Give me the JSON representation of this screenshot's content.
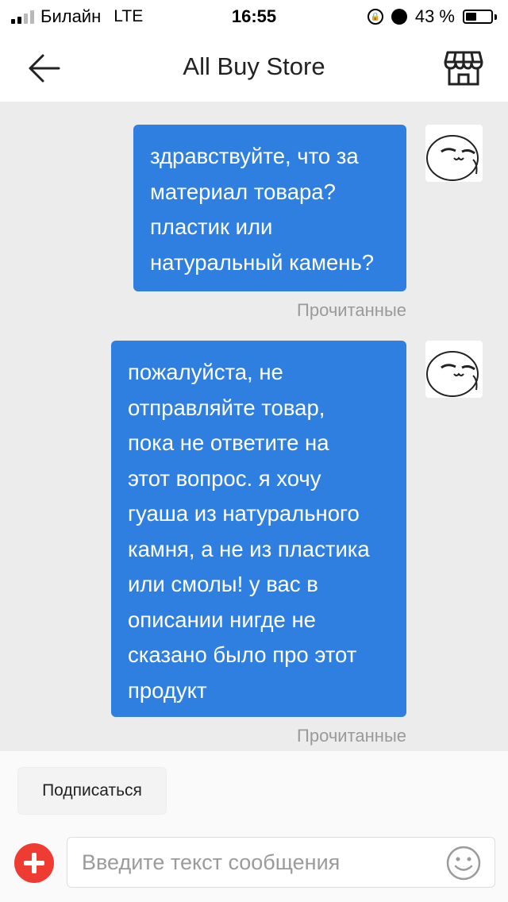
{
  "status_bar": {
    "carrier": "Билайн",
    "network": "LTE",
    "time": "16:55",
    "battery_text": "43 %",
    "battery_level": 0.43
  },
  "header": {
    "title": "All Buy Store",
    "back_icon": "arrow-left-icon",
    "store_icon": "storefront-icon"
  },
  "messages": [
    {
      "lines": [
        "здравствуйте, что за",
        "материал товара?",
        "пластик или",
        "натуральный камень?"
      ],
      "status": "Прочитанные"
    },
    {
      "lines": [
        "пожалуйста, не",
        "отправляйте товар,",
        "пока не ответите на",
        "этот вопрос. я хочу",
        "гуаша из натурального",
        "камня, а не из пластика",
        "или смолы! у вас в",
        "описании нигде не",
        "сказано было про этот",
        "продукт"
      ],
      "status": "Прочитанные"
    }
  ],
  "subscribe": {
    "label": "Подписаться"
  },
  "input": {
    "placeholder": "Введите текст сообщения",
    "value": ""
  },
  "colors": {
    "bubble": "#2f7fe0",
    "chat_bg": "#ececec",
    "add_button": "#ef3c33"
  }
}
